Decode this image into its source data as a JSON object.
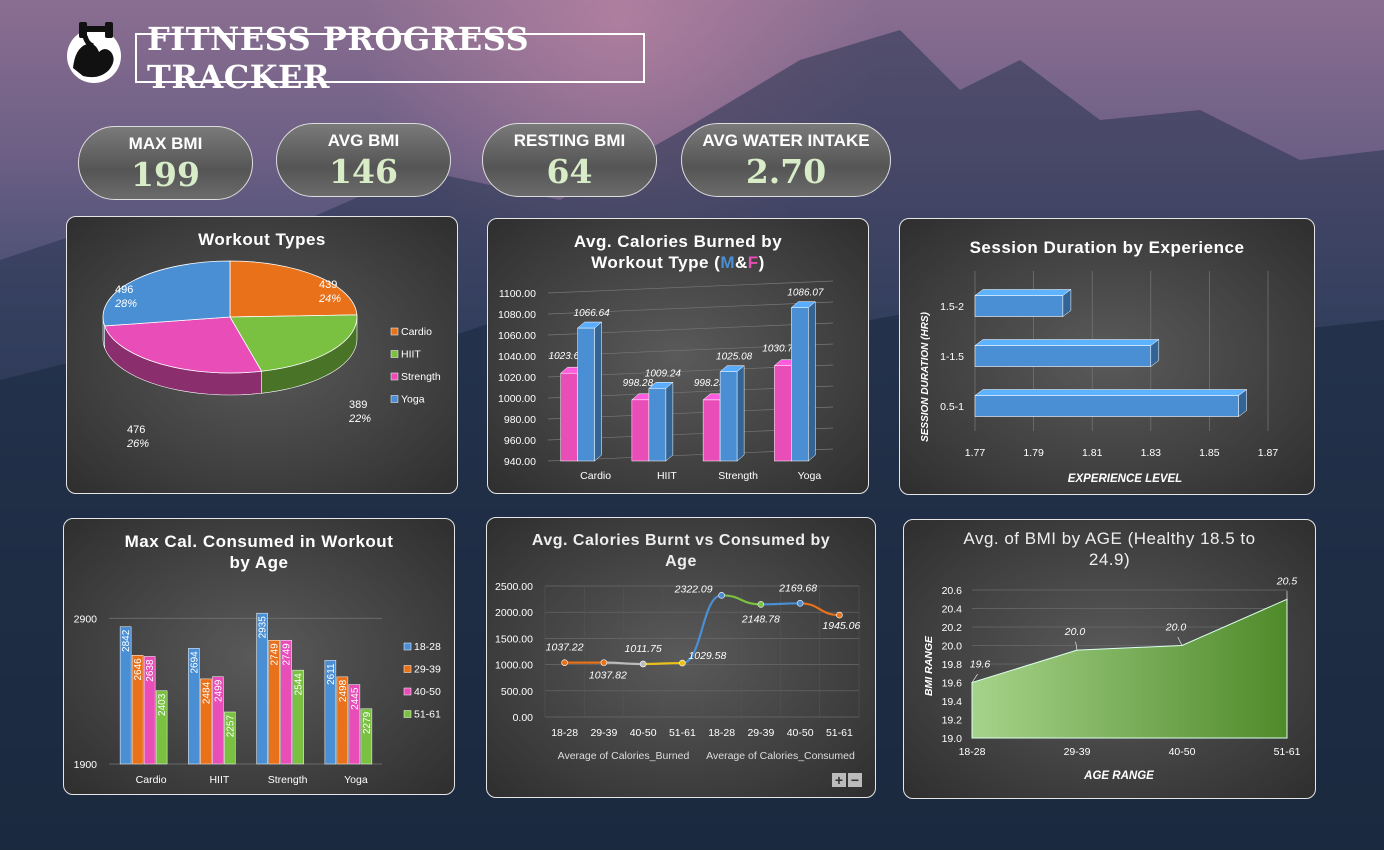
{
  "title": "FITNESS PROGRESS TRACKER",
  "kpis": [
    {
      "label": "MAX BMI",
      "value": "199"
    },
    {
      "label": "AVG BMI",
      "value": "146"
    },
    {
      "label": "RESTING BMI",
      "value": "64"
    },
    {
      "label": "AVG WATER INTAKE",
      "value": "2.70"
    }
  ],
  "colors": {
    "cardio": "#e8711a",
    "hiit": "#7ac142",
    "strength": "#e84db8",
    "yoga": "#4a8fd4",
    "female": "#e84db8",
    "male": "#4a8fd4",
    "green": "#5c9a34"
  },
  "chart_data": [
    {
      "type": "pie",
      "title": "Workout Types",
      "labels": [
        "Cardio",
        "HIIT",
        "Strength",
        "Yoga"
      ],
      "values": [
        439,
        389,
        476,
        496
      ],
      "percents": [
        "24%",
        "22%",
        "26%",
        "28%"
      ],
      "legend": "right"
    },
    {
      "type": "bar",
      "title_line1": "Avg. Calories Burned by",
      "title_line2": "Workout Type (",
      "title_m": "M",
      "title_amp": "&",
      "title_f": "F",
      "title_close": ")",
      "categories": [
        "Cardio",
        "HIIT",
        "Strength",
        "Yoga"
      ],
      "series": [
        {
          "values": [
            1023.63,
            998.28,
            998.23,
            1030.79
          ]
        },
        {
          "values": [
            1066.64,
            1009.24,
            1025.08,
            1086.07
          ]
        }
      ],
      "ylim": [
        940,
        1100
      ],
      "yticks": [
        "1100.00",
        "1080.00",
        "1060.00",
        "1040.00",
        "1020.00",
        "1000.00",
        "980.00",
        "960.00",
        "940.00"
      ],
      "labels": [
        [
          "1023.63",
          "1066.64"
        ],
        [
          "998.28",
          "1009.24"
        ],
        [
          "998.23",
          "1025.08"
        ],
        [
          "1030.79",
          "1086.07"
        ]
      ]
    },
    {
      "type": "bar",
      "orientation": "horizontal",
      "title": "Session Duration by Experience",
      "categories": [
        "1.5-2",
        "1-1.5",
        "0.5-1"
      ],
      "values": [
        1.8,
        1.83,
        1.86
      ],
      "xlim": [
        1.77,
        1.87
      ],
      "xticks": [
        "1.77",
        "1.79",
        "1.81",
        "1.83",
        "1.85",
        "1.87"
      ],
      "xlabel": "EXPERIENCE LEVEL",
      "ylabel": "SESSION DURATION (HRS)"
    },
    {
      "type": "bar",
      "title_line1": "Max Cal. Consumed in Workout",
      "title_line2": "by Age",
      "categories": [
        "Cardio",
        "HIIT",
        "Strength",
        "Yoga"
      ],
      "series": [
        {
          "name": "18-28",
          "values": [
            2842,
            2694,
            2935,
            2611
          ]
        },
        {
          "name": "29-39",
          "values": [
            2646,
            2484,
            2749,
            2498
          ]
        },
        {
          "name": "40-50",
          "values": [
            2638,
            2499,
            2749,
            2445
          ]
        },
        {
          "name": "51-61",
          "values": [
            2403,
            2257,
            2544,
            2279
          ]
        }
      ],
      "ylim": [
        1900,
        2950
      ],
      "yticks": [
        "2900",
        "1900"
      ],
      "legend": "right"
    },
    {
      "type": "line",
      "title_line1": "Avg. Calories Burnt vs Consumed by",
      "title_line2": "Age",
      "categories": [
        "18-28",
        "29-39",
        "40-50",
        "51-61",
        "18-28",
        "29-39",
        "40-50",
        "51-61"
      ],
      "groups": [
        "Average of Calories_Burned",
        "Average of Calories_Consumed"
      ],
      "values": [
        1037.22,
        1037.82,
        1011.75,
        1029.58,
        2322.09,
        2148.78,
        2169.68,
        1945.06
      ],
      "labels": [
        "1037.22",
        "1037.82",
        "1011.75",
        "1029.58",
        "2322.09",
        "2148.78",
        "2169.68",
        "1945.06"
      ],
      "ylim": [
        0,
        2500
      ],
      "yticks": [
        "2500.00",
        "2000.00",
        "1500.00",
        "1000.00",
        "500.00",
        "0.00"
      ]
    },
    {
      "type": "area",
      "title_line1": "Avg. of BMI by AGE (Healthy 18.5 to",
      "title_line2": "24.9)",
      "categories": [
        "18-28",
        "29-39",
        "40-50",
        "51-61"
      ],
      "values": [
        19.6,
        19.95,
        20.0,
        20.5
      ],
      "labels": [
        "19.6",
        "20.0",
        "20.0",
        "20.5"
      ],
      "ylim": [
        19.0,
        20.6
      ],
      "yticks": [
        "20.6",
        "20.4",
        "20.2",
        "20.0",
        "19.8",
        "19.6",
        "19.4",
        "19.2",
        "19.0"
      ],
      "xlabel": "AGE RANGE",
      "ylabel": "BMI RANGE"
    }
  ],
  "zoom_controls": {
    "plus": "+",
    "minus": "−"
  }
}
